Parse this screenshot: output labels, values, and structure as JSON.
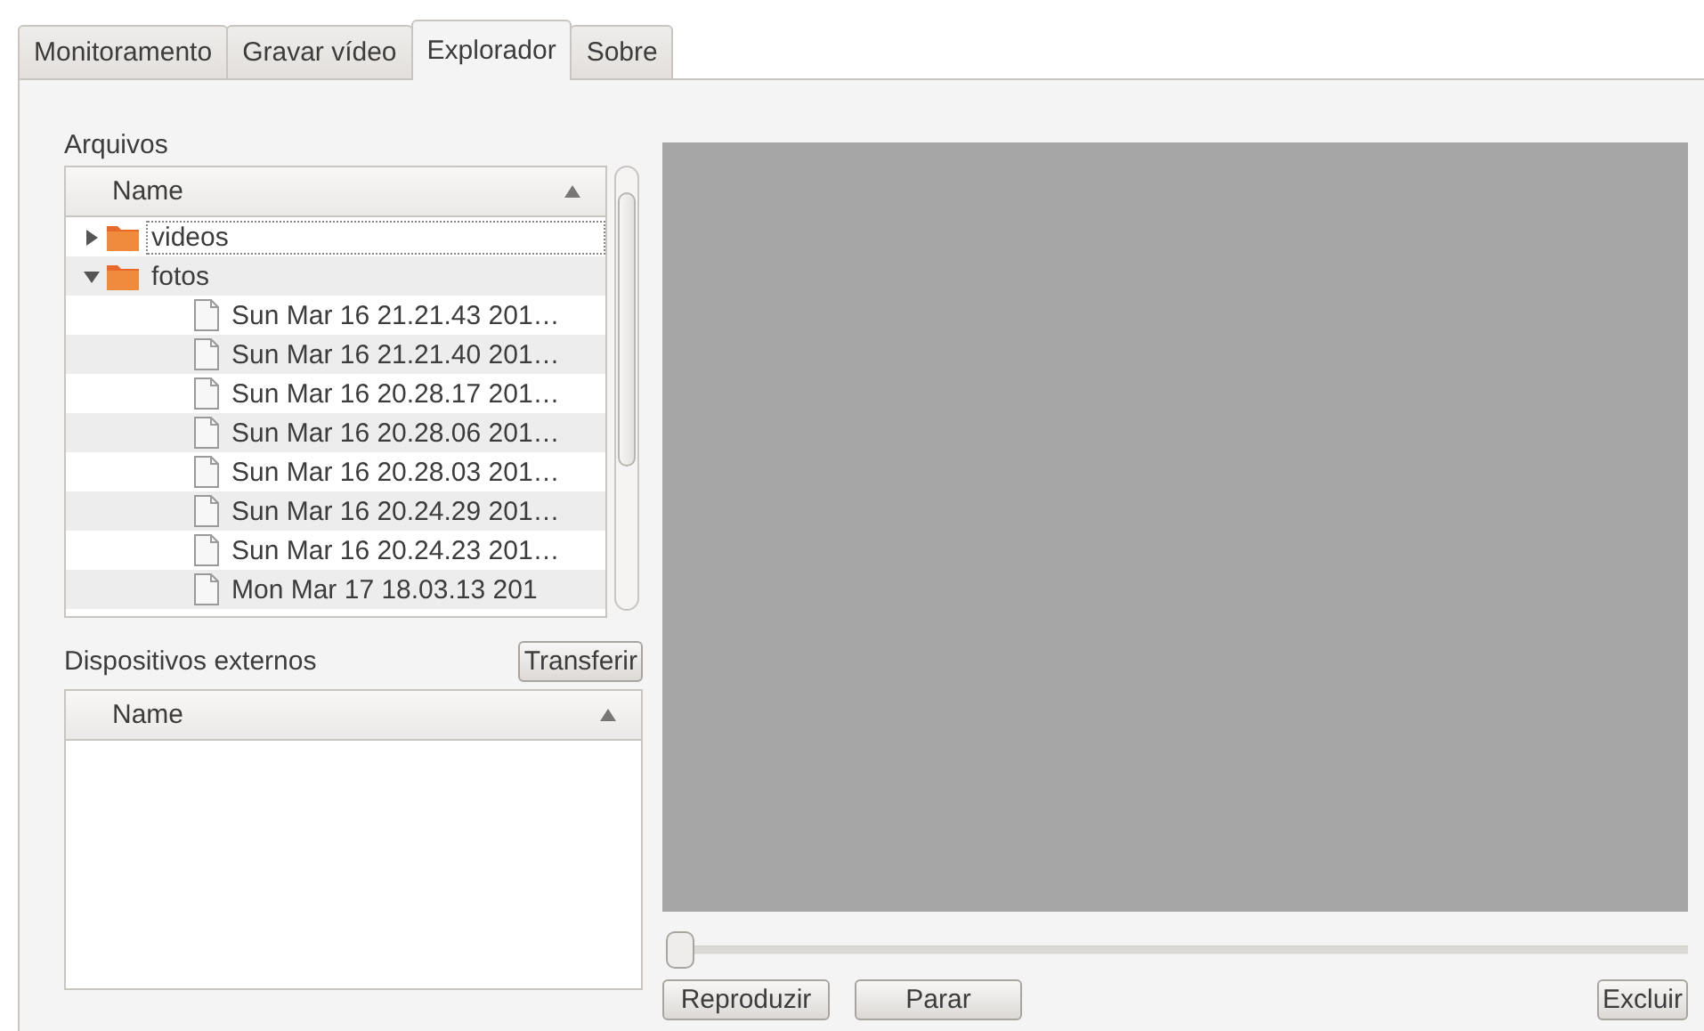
{
  "tabs": [
    {
      "label": "Monitoramento",
      "selected": false
    },
    {
      "label": "Gravar vídeo",
      "selected": false
    },
    {
      "label": "Explorador",
      "selected": true
    },
    {
      "label": "Sobre",
      "selected": false
    }
  ],
  "files": {
    "title": "Arquivos",
    "column": "Name",
    "items": [
      {
        "kind": "folder",
        "name": "videos",
        "expanded": false,
        "focused": true
      },
      {
        "kind": "folder",
        "name": "fotos",
        "expanded": true,
        "focused": false,
        "children": [
          {
            "kind": "file",
            "name": "Sun Mar 16 21.21.43 201…"
          },
          {
            "kind": "file",
            "name": "Sun Mar 16 21.21.40 201…"
          },
          {
            "kind": "file",
            "name": "Sun Mar 16 20.28.17 201…"
          },
          {
            "kind": "file",
            "name": "Sun Mar 16 20.28.06 201…"
          },
          {
            "kind": "file",
            "name": "Sun Mar 16 20.28.03 201…"
          },
          {
            "kind": "file",
            "name": "Sun Mar 16 20.24.29 201…"
          },
          {
            "kind": "file",
            "name": "Sun Mar 16 20.24.23 201…"
          },
          {
            "kind": "file",
            "name": "Mon Mar 17 18.03.13 201"
          }
        ]
      }
    ]
  },
  "devices": {
    "title": "Dispositivos externos",
    "button": "Transferir",
    "column": "Name"
  },
  "player": {
    "level": 0,
    "buttons": [
      "Reproduzir",
      "Parar"
    ],
    "delete_button": "Excluir"
  }
}
